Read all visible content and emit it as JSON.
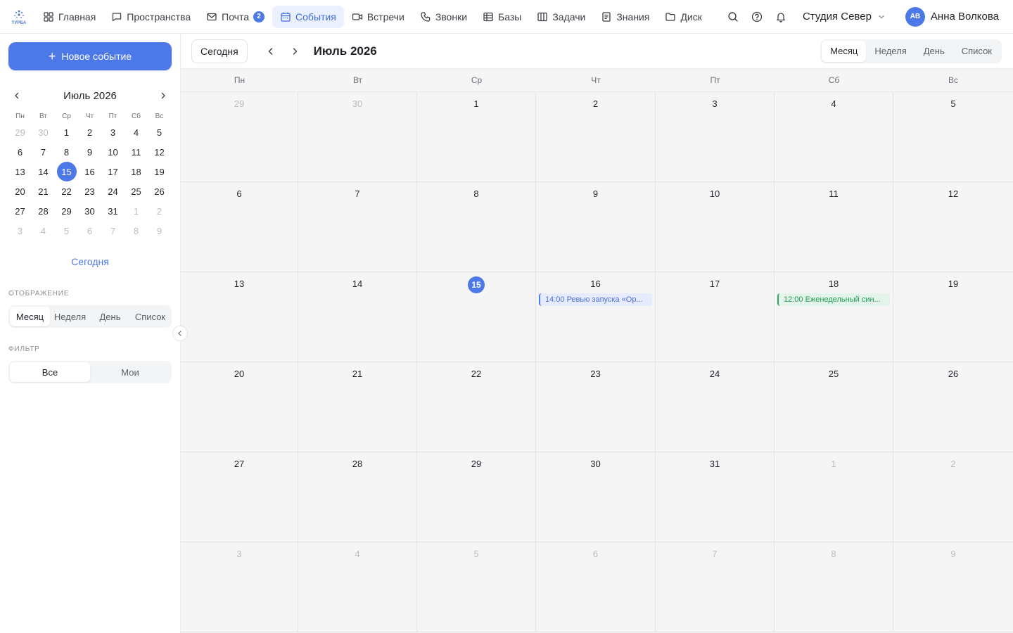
{
  "app": {
    "logo_text": "ТУРБА"
  },
  "nav": {
    "items": [
      {
        "label": "Главная",
        "icon": "grid-icon"
      },
      {
        "label": "Пространства",
        "icon": "chat-icon"
      },
      {
        "label": "Почта",
        "icon": "mail-icon",
        "badge": "2"
      },
      {
        "label": "События",
        "icon": "calendar-icon",
        "active": true
      },
      {
        "label": "Встречи",
        "icon": "video-icon"
      },
      {
        "label": "Звонки",
        "icon": "phone-icon"
      },
      {
        "label": "Базы",
        "icon": "table-icon"
      },
      {
        "label": "Задачи",
        "icon": "kanban-icon"
      },
      {
        "label": "Знания",
        "icon": "doc-icon"
      },
      {
        "label": "Диск",
        "icon": "folder-icon"
      }
    ]
  },
  "header": {
    "workspace": "Студия Север",
    "avatar_initials": "АВ",
    "user_name": "Анна Волкова"
  },
  "sidebar": {
    "new_event": "Новое событие",
    "mini_calendar": {
      "title": "Июль 2026",
      "weekdays": [
        "Пн",
        "Вт",
        "Ср",
        "Чт",
        "Пт",
        "Сб",
        "Вс"
      ],
      "days": [
        {
          "d": "29",
          "m": true
        },
        {
          "d": "30",
          "m": true
        },
        {
          "d": "1"
        },
        {
          "d": "2"
        },
        {
          "d": "3"
        },
        {
          "d": "4"
        },
        {
          "d": "5"
        },
        {
          "d": "6"
        },
        {
          "d": "7"
        },
        {
          "d": "8"
        },
        {
          "d": "9"
        },
        {
          "d": "10"
        },
        {
          "d": "11"
        },
        {
          "d": "12"
        },
        {
          "d": "13"
        },
        {
          "d": "14"
        },
        {
          "d": "15",
          "t": true
        },
        {
          "d": "16"
        },
        {
          "d": "17"
        },
        {
          "d": "18"
        },
        {
          "d": "19"
        },
        {
          "d": "20"
        },
        {
          "d": "21"
        },
        {
          "d": "22"
        },
        {
          "d": "23"
        },
        {
          "d": "24"
        },
        {
          "d": "25"
        },
        {
          "d": "26"
        },
        {
          "d": "27"
        },
        {
          "d": "28"
        },
        {
          "d": "29"
        },
        {
          "d": "30"
        },
        {
          "d": "31"
        },
        {
          "d": "1",
          "m": true
        },
        {
          "d": "2",
          "m": true
        },
        {
          "d": "3",
          "m": true
        },
        {
          "d": "4",
          "m": true
        },
        {
          "d": "5",
          "m": true
        },
        {
          "d": "6",
          "m": true
        },
        {
          "d": "7",
          "m": true
        },
        {
          "d": "8",
          "m": true
        },
        {
          "d": "9",
          "m": true
        }
      ]
    },
    "today_link": "Сегодня",
    "display_label": "Отображение",
    "display_options": [
      "Месяц",
      "Неделя",
      "День",
      "Список"
    ],
    "filter_label": "Фильтр",
    "filter_options": [
      "Все",
      "Мои"
    ]
  },
  "toolbar": {
    "today": "Сегодня",
    "month_title": "Июль 2026",
    "views": [
      "Месяц",
      "Неделя",
      "День",
      "Список"
    ]
  },
  "calendar": {
    "weekdays": [
      "Пн",
      "Вт",
      "Ср",
      "Чт",
      "Пт",
      "Сб",
      "Вс"
    ],
    "cells": [
      {
        "d": "29",
        "m": true
      },
      {
        "d": "30",
        "m": true
      },
      {
        "d": "1"
      },
      {
        "d": "2"
      },
      {
        "d": "3"
      },
      {
        "d": "4"
      },
      {
        "d": "5"
      },
      {
        "d": "6"
      },
      {
        "d": "7"
      },
      {
        "d": "8"
      },
      {
        "d": "9"
      },
      {
        "d": "10"
      },
      {
        "d": "11"
      },
      {
        "d": "12"
      },
      {
        "d": "13"
      },
      {
        "d": "14"
      },
      {
        "d": "15",
        "t": true
      },
      {
        "d": "16",
        "event": {
          "text": "14:00 Ревью запуска «Ор...",
          "color": "blue"
        }
      },
      {
        "d": "17"
      },
      {
        "d": "18",
        "event": {
          "text": "12:00 Еженедельный син...",
          "color": "green"
        }
      },
      {
        "d": "19"
      },
      {
        "d": "20"
      },
      {
        "d": "21"
      },
      {
        "d": "22"
      },
      {
        "d": "23"
      },
      {
        "d": "24"
      },
      {
        "d": "25"
      },
      {
        "d": "26"
      },
      {
        "d": "27"
      },
      {
        "d": "28"
      },
      {
        "d": "29"
      },
      {
        "d": "30"
      },
      {
        "d": "31"
      },
      {
        "d": "1",
        "m": true
      },
      {
        "d": "2",
        "m": true
      },
      {
        "d": "3",
        "m": true
      },
      {
        "d": "4",
        "m": true
      },
      {
        "d": "5",
        "m": true
      },
      {
        "d": "6",
        "m": true
      },
      {
        "d": "7",
        "m": true
      },
      {
        "d": "8",
        "m": true
      },
      {
        "d": "9",
        "m": true
      }
    ]
  },
  "colors": {
    "accent": "#4d78e8",
    "event_blue": "#4d78e8",
    "event_green": "#2aa65d"
  }
}
